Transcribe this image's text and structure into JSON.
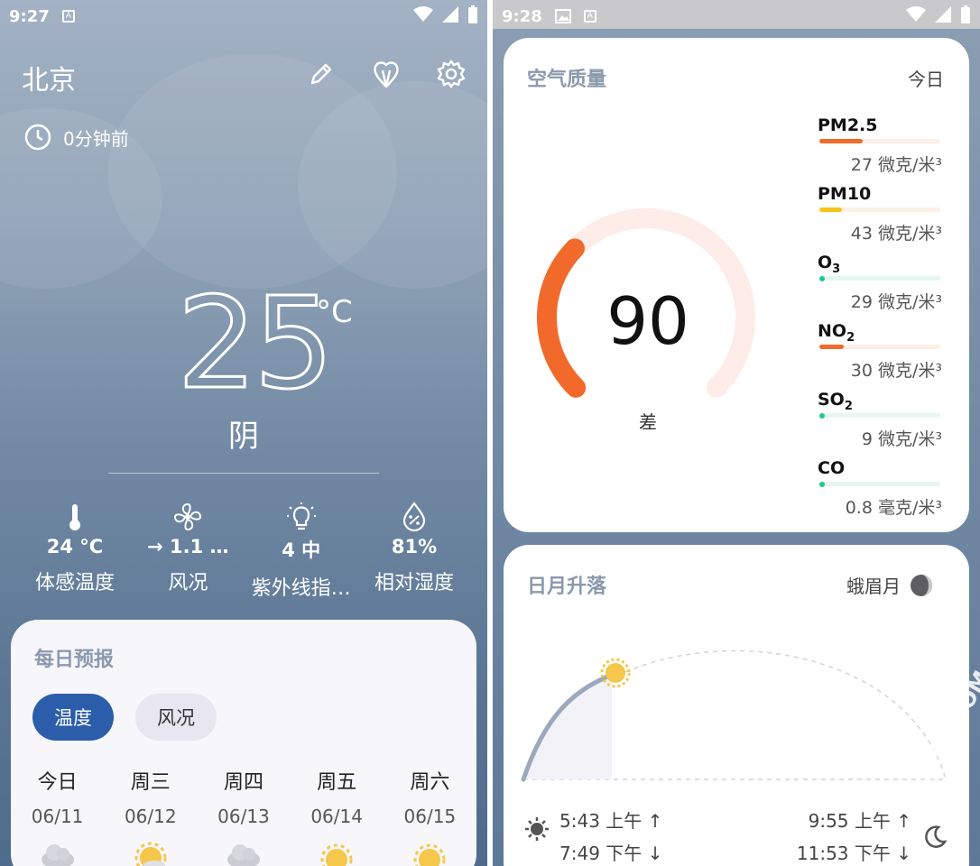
{
  "left_screen": {
    "status": {
      "time": "9:27",
      "notif_glyph": "A"
    },
    "header": {
      "city": "北京"
    },
    "updated": {
      "text": "0分钟前"
    },
    "current": {
      "temperature": "25",
      "unit": "°C",
      "condition": "阴"
    },
    "metrics": [
      {
        "icon": "thermometer-icon",
        "value": "24 °C",
        "label": "体感温度"
      },
      {
        "icon": "fan-icon",
        "value": "→ 1.1 …",
        "label": "风况"
      },
      {
        "icon": "lightbulb-icon",
        "value": "4 中",
        "label": "紫外线指…"
      },
      {
        "icon": "humidity-drop-icon",
        "value": "81%",
        "label": "相对湿度"
      }
    ],
    "daily_forecast": {
      "title": "每日预报",
      "chips": [
        "温度",
        "风况"
      ],
      "selected_chip": "温度",
      "days": [
        {
          "name": "今日",
          "date": "06/11",
          "icon": "cloudy-icon"
        },
        {
          "name": "周三",
          "date": "06/12",
          "icon": "partly-sunny-icon"
        },
        {
          "name": "周四",
          "date": "06/13",
          "icon": "cloudy-icon"
        },
        {
          "name": "周五",
          "date": "06/14",
          "icon": "sunny-icon"
        },
        {
          "name": "周六",
          "date": "06/15",
          "icon": "sunny-icon"
        }
      ]
    }
  },
  "right_screen": {
    "status": {
      "time": "9:28",
      "notif_glyph": "A"
    },
    "air_quality": {
      "title": "空气质量",
      "period": "今日",
      "aqi": "90",
      "aqi_level": "差",
      "aqi_fraction": 0.33,
      "accent_color": "#f26a2b",
      "pollutants": [
        {
          "name": "PM2.5",
          "sub": "",
          "value": "27 微克/米³",
          "level": 0.36,
          "color": "#f26a2b",
          "track": "#fdeee6"
        },
        {
          "name": "PM10",
          "sub": "",
          "value": "43 微克/米³",
          "level": 0.19,
          "color": "#f5c518",
          "track": "#fdf1e6"
        },
        {
          "name": "O",
          "sub": "3",
          "value": "29 微克/米³",
          "level": 0.0,
          "color": "#1ec98a",
          "track": "#e6f6f1"
        },
        {
          "name": "NO",
          "sub": "2",
          "value": "30 微克/米³",
          "level": 0.2,
          "color": "#f26a2b",
          "track": "#fdeee6"
        },
        {
          "name": "SO",
          "sub": "2",
          "value": "9 微克/米³",
          "level": 0.0,
          "color": "#1ec98a",
          "track": "#e6f6f1"
        },
        {
          "name": "CO",
          "sub": "",
          "value": "0.8 毫克/米³",
          "level": 0.0,
          "color": "#1ec98a",
          "track": "#e6f6f1"
        }
      ]
    },
    "sun_moon": {
      "title": "日月升落",
      "moon_phase": "蛾眉月",
      "sunrise": "5:43 上午 ↑",
      "sunset": "7:49 下午 ↓",
      "moonrise": "9:55 上午 ↑",
      "moonset": "11:53 下午 ↓"
    }
  },
  "watermark": "OSSSR.COM"
}
